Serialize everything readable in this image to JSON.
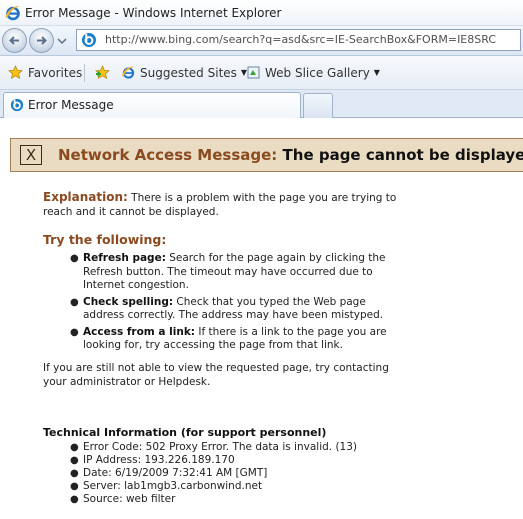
{
  "window": {
    "title": "Error Message - Windows Internet Explorer"
  },
  "address_bar": {
    "url": "http://www.bing.com/search?q=asd&src=IE-SearchBox&FORM=IE8SRC"
  },
  "favorites_bar": {
    "favorites_label": "Favorites",
    "suggested_sites_label": "Suggested Sites",
    "web_slice_gallery_label": "Web Slice Gallery"
  },
  "tabs": [
    {
      "label": "Error Message"
    }
  ],
  "error_page": {
    "banner": {
      "icon": "X",
      "label": "Network Access Message:",
      "message": "The page cannot be displayed"
    },
    "explanation": {
      "heading": "Explanation:",
      "text": "There is a problem with the page you are trying to reach and it cannot be displayed."
    },
    "try_heading": "Try the following:",
    "tips": [
      {
        "title": "Refresh page:",
        "text": "Search for the page again by clicking the Refresh button. The timeout may have occurred due to Internet congestion."
      },
      {
        "title": "Check spelling:",
        "text": "Check that you typed the Web page address correctly. The address may have been mistyped."
      },
      {
        "title": "Access from a link:",
        "text": "If there is a link to the page you are looking for, try accessing the page from that link."
      }
    ],
    "contact_text": "If you are still not able to view the requested page, try contacting your administrator or Helpdesk.",
    "technical": {
      "heading": "Technical Information (for support personnel)",
      "items": [
        "Error Code: 502 Proxy Error. The data is invalid. (13)",
        "IP Address: 193.226.189.170",
        "Date: 6/19/2009 7:32:41 AM [GMT]",
        "Server: lab1mgb3.carbonwind.net",
        "Source: web filter"
      ]
    }
  },
  "colors": {
    "accent": "#8b4a20",
    "banner_bg": "#e9dcc2",
    "banner_border": "#a37f54",
    "chrome": "#dde7f3"
  },
  "icons": [
    "ie-logo-icon",
    "back-arrow-icon",
    "forward-arrow-icon",
    "bing-icon",
    "favorites-star-icon",
    "add-favorites-icon",
    "suggested-sites-icon",
    "web-slice-icon",
    "error-x-icon"
  ]
}
